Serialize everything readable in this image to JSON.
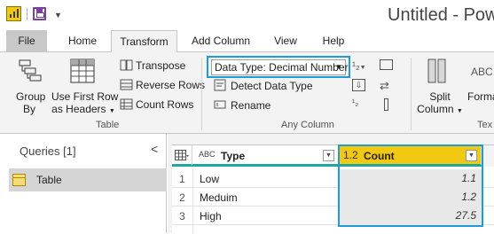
{
  "window": {
    "title": "Untitled - Pow"
  },
  "tabs": {
    "file": "File",
    "home": "Home",
    "transform": "Transform",
    "add_column": "Add Column",
    "view": "View",
    "help": "Help"
  },
  "ribbon": {
    "table_group": {
      "label": "Table",
      "group_by": [
        "Group",
        "By"
      ],
      "use_first_row": [
        "Use First Row",
        "as Headers"
      ],
      "transpose": "Transpose",
      "reverse_rows": "Reverse Rows",
      "count_rows": "Count Rows"
    },
    "any_column_group": {
      "label": "Any Column",
      "data_type": "Data Type: Decimal Number",
      "detect_data_type": "Detect Data Type",
      "rename": "Rename"
    },
    "text_group": {
      "label": "Tex",
      "split_column": [
        "Split",
        "Column"
      ],
      "format": "Forma"
    }
  },
  "queries": {
    "title": "Queries [1]",
    "items": [
      "Table"
    ]
  },
  "grid": {
    "columns": [
      {
        "type_icon": "ABC",
        "name": "Type"
      },
      {
        "type_icon": "1.2",
        "name": "Count"
      }
    ],
    "rows": [
      {
        "num": "1",
        "type": "Low",
        "count": "1.1"
      },
      {
        "num": "2",
        "type": "Meduim",
        "count": "1.2"
      },
      {
        "num": "3",
        "type": "High",
        "count": "27.5"
      }
    ]
  },
  "colors": {
    "accent_highlight": "#1f9bd7",
    "count_header": "#f2c811",
    "header_underline": "#1fa8a0"
  }
}
